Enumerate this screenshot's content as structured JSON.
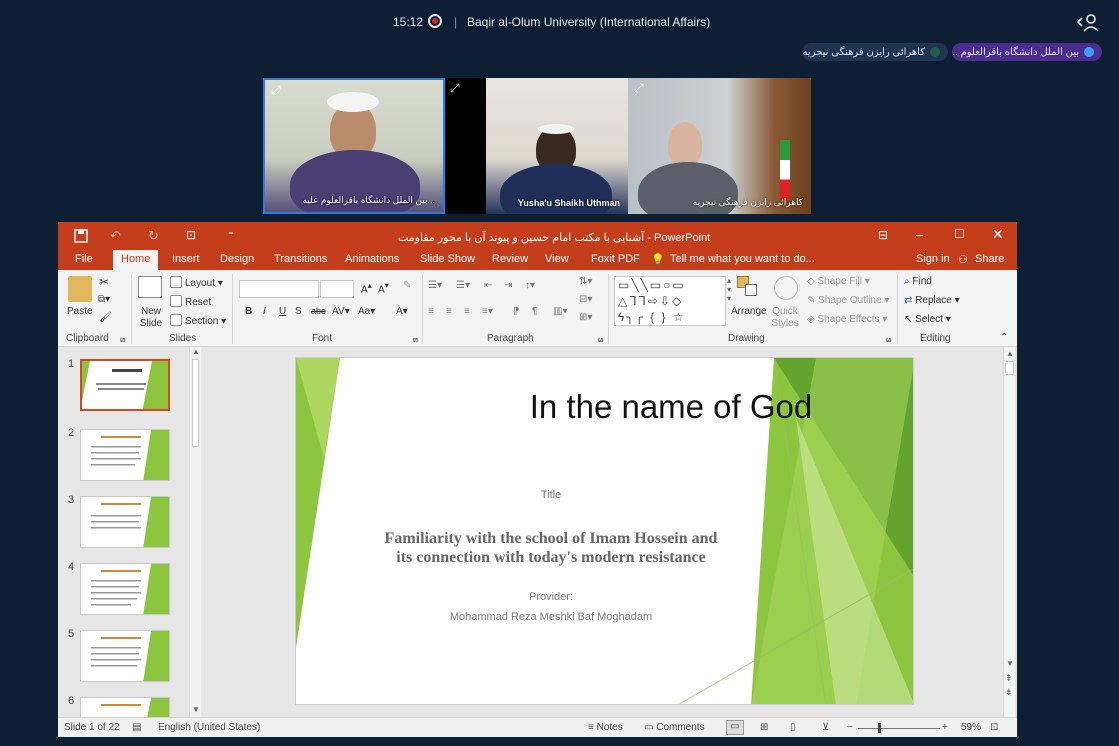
{
  "meeting": {
    "time": "15:12",
    "room_title": "Baqir al-Olum University (International Affairs)",
    "speaker_pills": [
      "بین الملل دانشگاه باقرالعلوم ...",
      "کاهرائی رایزن فرهنگی نیجریه"
    ],
    "participants": [
      {
        "name": "بین الملل دانشگاه باقرالعلوم علیه..."
      },
      {
        "name": "Yusha'u Shaikh Uthman"
      },
      {
        "name": "کاهرائی رایزن فرهنگی نیجریه"
      }
    ]
  },
  "ppt": {
    "window_title": "آشنایی با مکتب امام حسین و پیوند آن با محور مقاومت - PowerPoint",
    "tabs": [
      "File",
      "Home",
      "Insert",
      "Design",
      "Transitions",
      "Animations",
      "Slide Show",
      "Review",
      "View",
      "Foxit PDF"
    ],
    "active_tab": "Home",
    "tell_me": "Tell me what you want to do...",
    "sign_in": "Sign in",
    "share": "Share",
    "groups": {
      "clipboard": "Clipboard",
      "slides": "Slides",
      "font": "Font",
      "paragraph": "Paragraph",
      "drawing": "Drawing",
      "editing": "Editing"
    },
    "ribbon": {
      "paste": "Paste",
      "new_slide": "New Slide",
      "layout": "Layout",
      "reset": "Reset",
      "section": "Section",
      "arrange": "Arrange",
      "quick_styles": "Quick Styles",
      "shape_fill": "Shape Fill",
      "shape_outline": "Shape Outline",
      "shape_effects": "Shape Effects",
      "find": "Find",
      "replace": "Replace",
      "select": "Select"
    },
    "thumb_numbers": [
      "1",
      "2",
      "3",
      "4",
      "5",
      "6"
    ],
    "slide": {
      "title": "In the name of God",
      "subtitle": "Title",
      "main_line1": "Familiarity with the school of Imam Hossein and",
      "main_line2": "its connection with today's modern resistance",
      "provider_label": "Provider:",
      "provider_name": "Mohammad Reza Meshki Baf Moghadam"
    },
    "status": {
      "slide_count": "Slide 1 of 22",
      "language": "English (United States)",
      "notes": "Notes",
      "comments": "Comments",
      "zoom": "59%"
    }
  }
}
